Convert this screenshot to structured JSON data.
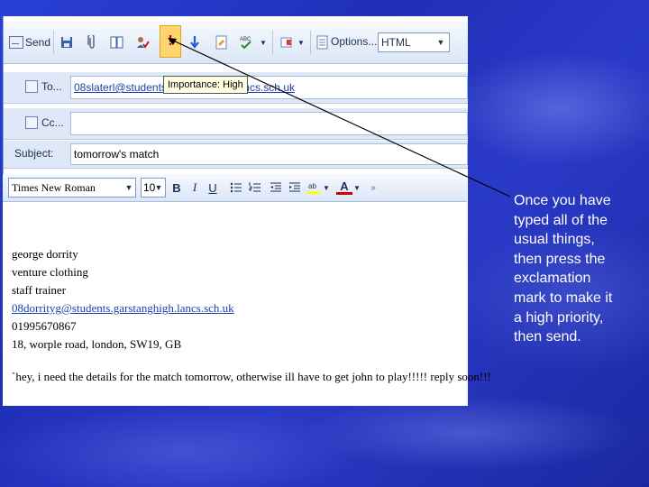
{
  "toolbar": {
    "send_label": "Send",
    "options_label": "Options...",
    "format": "HTML",
    "importance_tooltip": "Importance: High",
    "importance_glyph": "!"
  },
  "header": {
    "to_label": "To...",
    "to_value": "08slaterl@students.garstanghigh.lancs.sch.uk",
    "cc_label": "Cc...",
    "cc_value": "",
    "subject_label": "Subject:",
    "subject_value": "tomorrow's match"
  },
  "formatting": {
    "font": "Times New Roman",
    "size": "10",
    "bold": "B",
    "italic": "I",
    "underline": "U",
    "font_color_glyph": "A"
  },
  "message": {
    "signature": [
      "george dorrity",
      "venture clothing",
      "staff trainer"
    ],
    "email": "08dorrityg@students.garstanghigh.lancs.sch.uk",
    "phone": "01995670867",
    "address": "18, worple road, london, SW19, GB",
    "body": "`hey, i need the details for the match tomorrow, otherwise ill have to get john to play!!!!! reply soon!!!"
  },
  "instruction_text": "Once you have typed all of the usual things, then press the exclamation mark to make it a high priority, then send.",
  "colors": {
    "background": "#2235c4",
    "importance_button": "#ffd66b",
    "importance_glyph": "#c30000",
    "link": "#1a3faa"
  }
}
